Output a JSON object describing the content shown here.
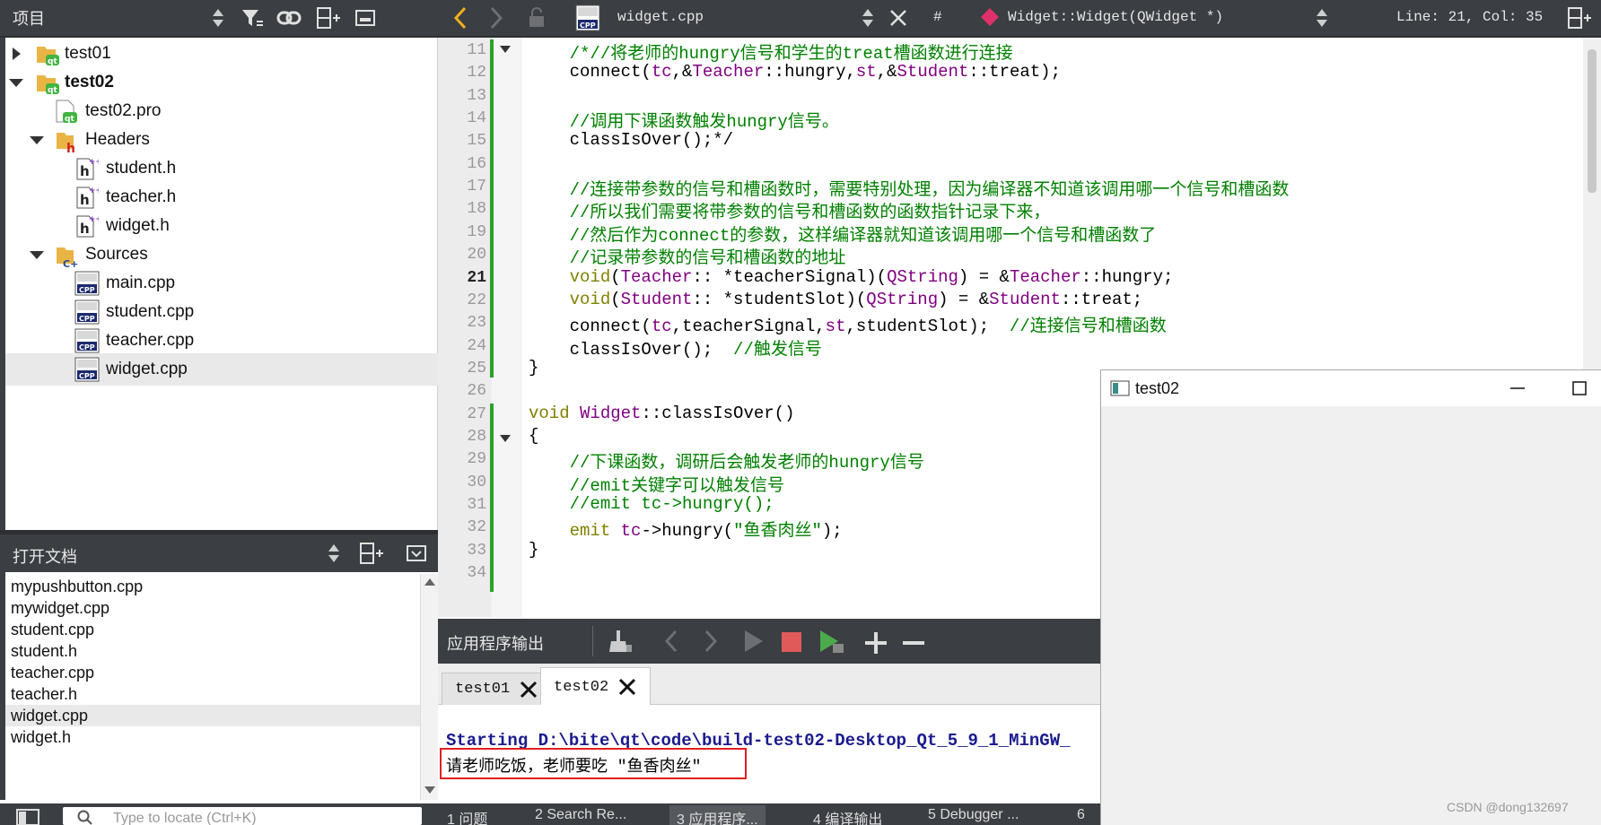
{
  "project_panel": {
    "title": "项目",
    "tree": [
      {
        "label": "test01",
        "expanded": false,
        "bold": false,
        "icon": "qt-project-icon"
      },
      {
        "label": "test02",
        "expanded": true,
        "bold": true,
        "icon": "qt-project-icon"
      },
      {
        "label": "test02.pro",
        "icon": "pro-file-icon"
      },
      {
        "label": "Headers",
        "expanded": true,
        "icon": "headers-folder-icon"
      },
      {
        "label": "student.h",
        "icon": "header-file-icon"
      },
      {
        "label": "teacher.h",
        "icon": "header-file-icon"
      },
      {
        "label": "widget.h",
        "icon": "header-file-icon"
      },
      {
        "label": "Sources",
        "expanded": true,
        "icon": "sources-folder-icon"
      },
      {
        "label": "main.cpp",
        "icon": "cpp-file-icon"
      },
      {
        "label": "student.cpp",
        "icon": "cpp-file-icon"
      },
      {
        "label": "teacher.cpp",
        "icon": "cpp-file-icon"
      },
      {
        "label": "widget.cpp",
        "icon": "cpp-file-icon",
        "selected": true
      }
    ]
  },
  "open_docs": {
    "title": "打开文档",
    "items": [
      "mypushbutton.cpp",
      "mywidget.cpp",
      "student.cpp",
      "student.h",
      "teacher.cpp",
      "teacher.h",
      "widget.cpp",
      "widget.h"
    ],
    "selected_index": 6
  },
  "locator": {
    "placeholder": "Type to locate (Ctrl+K)"
  },
  "editor_toolbar": {
    "filename": "widget.cpp",
    "hash": "#",
    "symbol": "Widget::Widget(QWidget *)",
    "position": "Line: 21, Col: 35"
  },
  "editor": {
    "current_line": 21,
    "lines": [
      {
        "n": "11",
        "text": "    /*//将老师的hungry信号和学生的treat槽函数进行连接"
      },
      {
        "n": "12",
        "text": "    connect(tc,&Teacher::hungry,st,&Student::treat);"
      },
      {
        "n": "13",
        "text": ""
      },
      {
        "n": "14",
        "text": "    //调用下课函数触发hungry信号。"
      },
      {
        "n": "15",
        "text": "    classIsOver();*/"
      },
      {
        "n": "16",
        "text": ""
      },
      {
        "n": "17",
        "text": "    //连接带参数的信号和槽函数时，需要特别处理，因为编译器不知道该调用哪一个信号和槽函数"
      },
      {
        "n": "18",
        "text": "    //所以我们需要将带参数的信号和槽函数的函数指针记录下来，"
      },
      {
        "n": "19",
        "text": "    //然后作为connect的参数，这样编译器就知道该调用哪一个信号和槽函数了"
      },
      {
        "n": "20",
        "text": "    //记录带参数的信号和槽函数的地址"
      },
      {
        "n": "21",
        "text": "    void(Teacher:: *teacherSignal)(QString) = &Teacher::hungry;"
      },
      {
        "n": "22",
        "text": "    void(Student:: *studentSlot)(QString) = &Student::treat;"
      },
      {
        "n": "23",
        "text": "    connect(tc,teacherSignal,st,studentSlot);  //连接信号和槽函数"
      },
      {
        "n": "24",
        "text": "    classIsOver();  //触发信号"
      },
      {
        "n": "25",
        "text": "}"
      },
      {
        "n": "26",
        "text": ""
      },
      {
        "n": "27",
        "text": "void Widget::classIsOver()"
      },
      {
        "n": "28",
        "text": "{"
      },
      {
        "n": "29",
        "text": "    //下课函数，调研后会触发老师的hungry信号"
      },
      {
        "n": "30",
        "text": "    //emit关键字可以触发信号"
      },
      {
        "n": "31",
        "text": "    //emit tc->hungry();"
      },
      {
        "n": "32",
        "text": "    emit tc->hungry(\"鱼香肉丝\");"
      },
      {
        "n": "33",
        "text": "}"
      },
      {
        "n": "34",
        "text": ""
      }
    ]
  },
  "output": {
    "title": "应用程序输出",
    "tabs": [
      "test01",
      "test02"
    ],
    "active_tab": 1,
    "lines": [
      "Starting D:\\bite\\qt\\code\\build-test02-Desktop_Qt_5_9_1_MinGW_",
      "请老师吃饭，老师要吃 \"鱼香肉丝\""
    ]
  },
  "bottom_bar": {
    "items": [
      "1  问题",
      "2  Search Re...",
      "3  应用程序...",
      "4  编译输出",
      "5  Debugger ...",
      "6"
    ]
  },
  "popup_window": {
    "title": "test02"
  },
  "watermark": "CSDN @dong132697",
  "colors": {
    "panel_dark": "#3b3e42",
    "comment": "#008000",
    "keyword": "#808000",
    "type": "#800080",
    "change_bar": "#2aa32a",
    "output_start": "#1b1b8f",
    "highlight_box": "#e02020"
  }
}
